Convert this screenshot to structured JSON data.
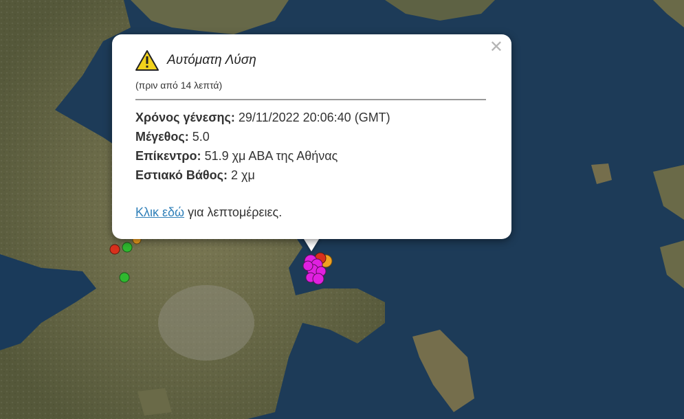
{
  "popup": {
    "title": "Αυτόματη Λύση",
    "time_ago": "(πριν από 14 λεπτά)",
    "origin_time_label": "Χρόνος γένεσης:",
    "origin_time_value": "29/11/2022 20:06:40 (GMT)",
    "magnitude_label": "Μέγεθος:",
    "magnitude_value": "5.0",
    "epicenter_label": "Επίκεντρο:",
    "epicenter_value": "51.9 χμ ΑΒΑ της Αθήνας",
    "depth_label": "Εστιακό Βάθος:",
    "depth_value": "2 χμ",
    "link_text": "Κλικ εδώ",
    "link_suffix": "για λεπτομέρειες.",
    "close_icon": "close-icon",
    "warning_icon": "warning-icon"
  },
  "colors": {
    "sea": "#1b3a57",
    "land": "#6b6a4a",
    "marker_magenta": "#e020e0",
    "marker_red": "#d8301c",
    "marker_orange": "#f0a020",
    "marker_green": "#2fb82f",
    "link": "#2f7fb8"
  }
}
